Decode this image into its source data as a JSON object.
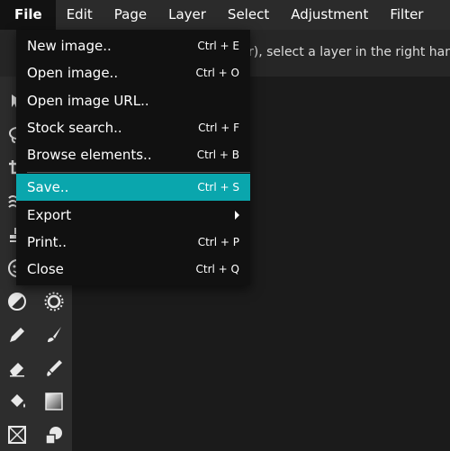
{
  "menubar": {
    "items": [
      "File",
      "Edit",
      "Page",
      "Layer",
      "Select",
      "Adjustment",
      "Filter"
    ]
  },
  "hint": {
    "text": "No layer (or empty layer), select a layer in the right hand"
  },
  "file_menu": {
    "items": [
      {
        "label": "New image..",
        "shortcut": "Ctrl + E"
      },
      {
        "label": "Open image..",
        "shortcut": "Ctrl + O"
      },
      {
        "label": "Open image URL..",
        "shortcut": ""
      },
      {
        "label": "Stock search..",
        "shortcut": "Ctrl + F"
      },
      {
        "label": "Browse elements..",
        "shortcut": "Ctrl + B"
      },
      {
        "label": "Save..",
        "shortcut": "Ctrl + S"
      },
      {
        "label": "Export",
        "shortcut": ""
      },
      {
        "label": "Print..",
        "shortcut": "Ctrl + P"
      },
      {
        "label": "Close",
        "shortcut": "Ctrl + Q"
      }
    ],
    "selected": "Save.."
  },
  "toolbar": {
    "tools": [
      "move-icon",
      "lasso-icon",
      "crop-icon",
      "liquify-icon",
      "stamp-icon",
      "sticker-icon",
      "dodge-burn-icon",
      "brightness-icon",
      "pencil-icon",
      "brush-icon",
      "eraser-icon",
      "color-replace-icon",
      "paint-bucket-icon",
      "gradient-icon",
      "image-placeholder-icon",
      "shape-icon"
    ]
  },
  "colors": {
    "accent": "#0aa6ad",
    "menubar_bg": "#2b2b2b",
    "dropdown_bg": "#111111",
    "toolbar_bg": "#2d2d2d"
  }
}
